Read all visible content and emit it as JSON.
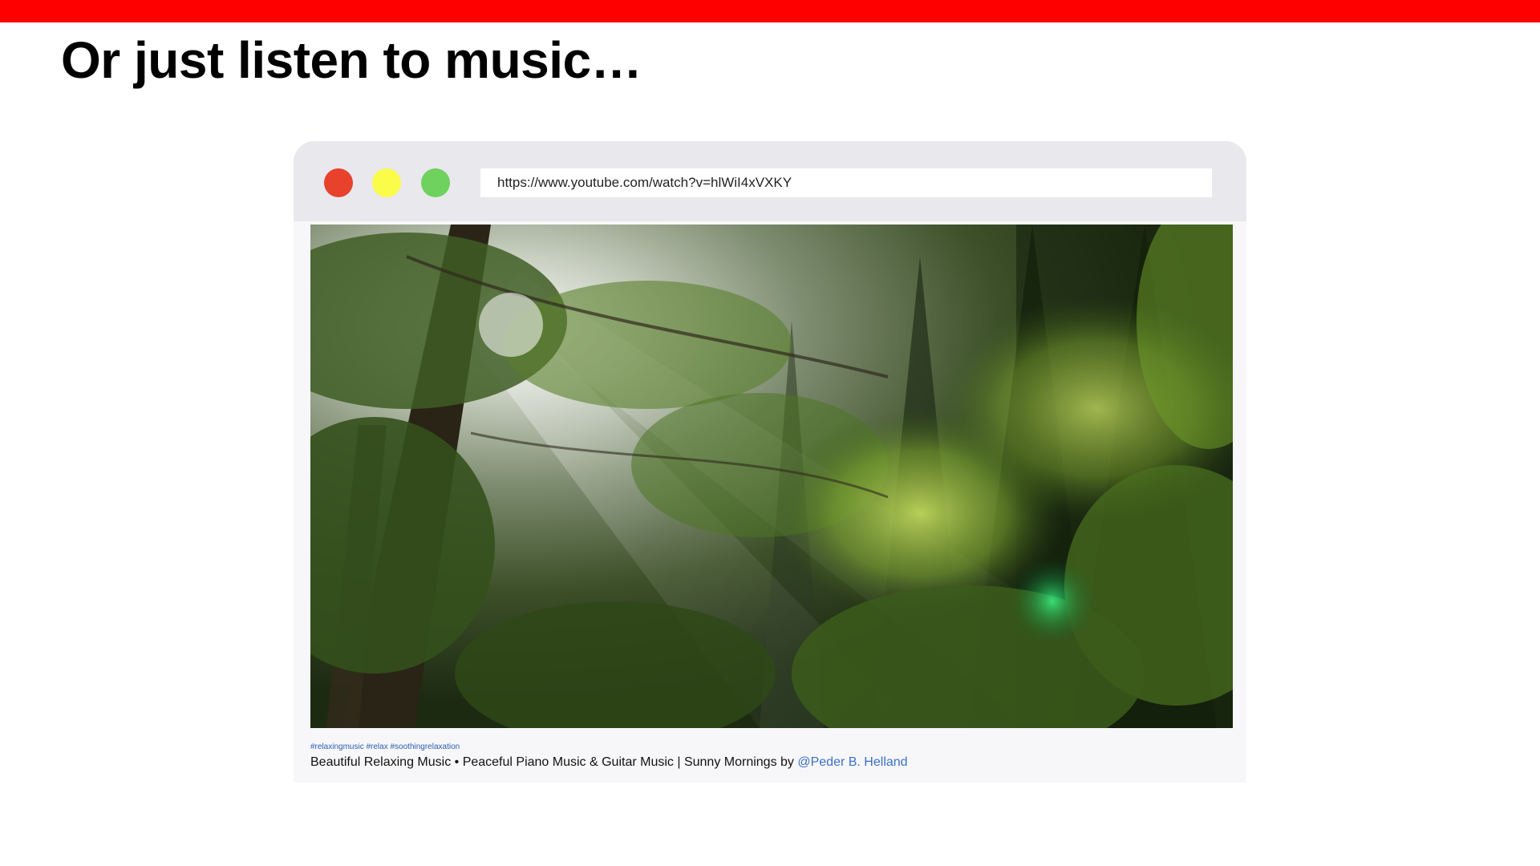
{
  "slide": {
    "title": "Or just listen to music…",
    "accent_color": "#ff0000"
  },
  "browser": {
    "window_buttons": [
      {
        "name": "close",
        "color": "#e8412c"
      },
      {
        "name": "minimize",
        "color": "#fbfb4a"
      },
      {
        "name": "maximize",
        "color": "#6fd15e"
      }
    ],
    "url": "https://www.youtube.com/watch?v=hlWiI4xVXKY"
  },
  "video": {
    "thumbnail_description_icon": "forest-sunlight-image",
    "hashtags": "#relaxingmusic #relax #soothingrelaxation",
    "title": "Beautiful Relaxing Music • Peaceful Piano Music & Guitar Music | Sunny Mornings by ",
    "channel": "@Peder B. Helland"
  }
}
